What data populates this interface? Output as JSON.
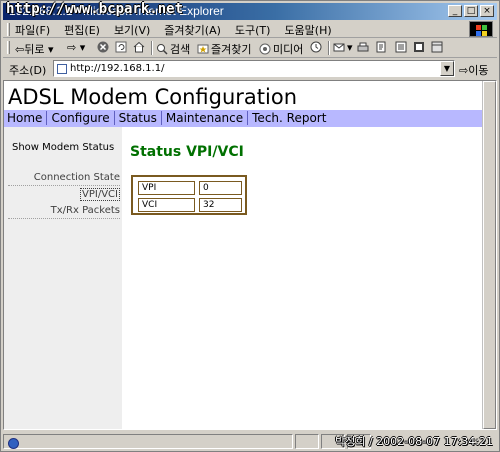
{
  "window": {
    "title": "192.168.1.1 - Microsoft Internet Explorer",
    "watermark": "http://www.bcpark.net",
    "buttons": [
      "_",
      "□",
      "×"
    ]
  },
  "menu": {
    "items": [
      "파일(F)",
      "편집(E)",
      "보기(V)",
      "즐겨찾기(A)",
      "도구(T)",
      "도움말(H)"
    ]
  },
  "toolbar": {
    "back": "뒤로",
    "search": "검색",
    "favorites": "즐겨찾기",
    "media": "미디어"
  },
  "address": {
    "label": "주소(D)",
    "url": "http://192.168.1.1/",
    "go": "이동"
  },
  "page": {
    "title": "ADSL Modem Configuration",
    "nav": [
      "Home",
      "Configure",
      "Status",
      "Maintenance",
      "Tech. Report"
    ],
    "sidebar": {
      "heading": "Show Modem Status",
      "links": [
        "Connection State",
        "VPI/VCI",
        "Tx/Rx Packets"
      ]
    },
    "section_title": "Status VPI/VCI",
    "rows": [
      {
        "label": "VPI",
        "value": "0"
      },
      {
        "label": "VCI",
        "value": "32"
      }
    ]
  },
  "status": {
    "stamp": "박정희 / 2002-08-07 17:34:21"
  },
  "colors": {
    "nav_bg": "#b8b8ff",
    "section_title": "#007000",
    "box_border": "#7a5a20"
  }
}
